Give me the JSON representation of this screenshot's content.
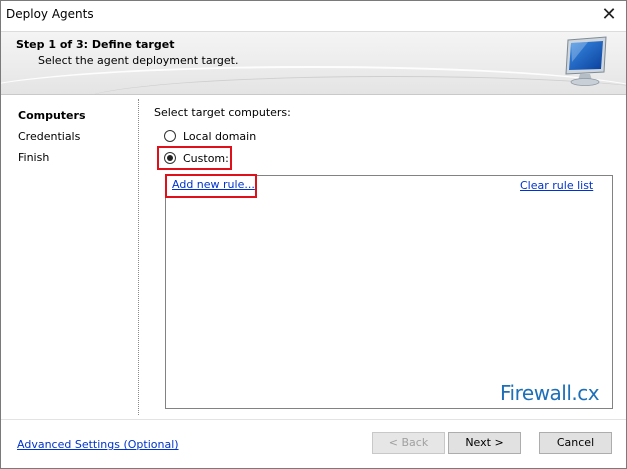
{
  "window": {
    "title": "Deploy Agents",
    "close_icon": "close-icon"
  },
  "header": {
    "step_title": "Step 1 of 3: Define target",
    "step_subtitle": "Select the agent deployment target.",
    "icon": "monitor-icon"
  },
  "nav": {
    "items": [
      {
        "label": "Computers",
        "active": true
      },
      {
        "label": "Credentials",
        "active": false
      },
      {
        "label": "Finish",
        "active": false
      }
    ]
  },
  "main": {
    "prompt": "Select target computers:",
    "options": [
      {
        "label": "Local domain",
        "selected": false
      },
      {
        "label": "Custom:",
        "selected": true
      }
    ],
    "add_rule_link": "Add new rule...",
    "clear_rules_link": "Clear rule list",
    "watermark": "Firewall.cx"
  },
  "footer": {
    "advanced_link": "Advanced Settings (Optional)",
    "back_label": "< Back",
    "next_label": "Next >",
    "cancel_label": "Cancel"
  },
  "colors": {
    "highlight": "#e0101a",
    "link": "#0033cc"
  }
}
